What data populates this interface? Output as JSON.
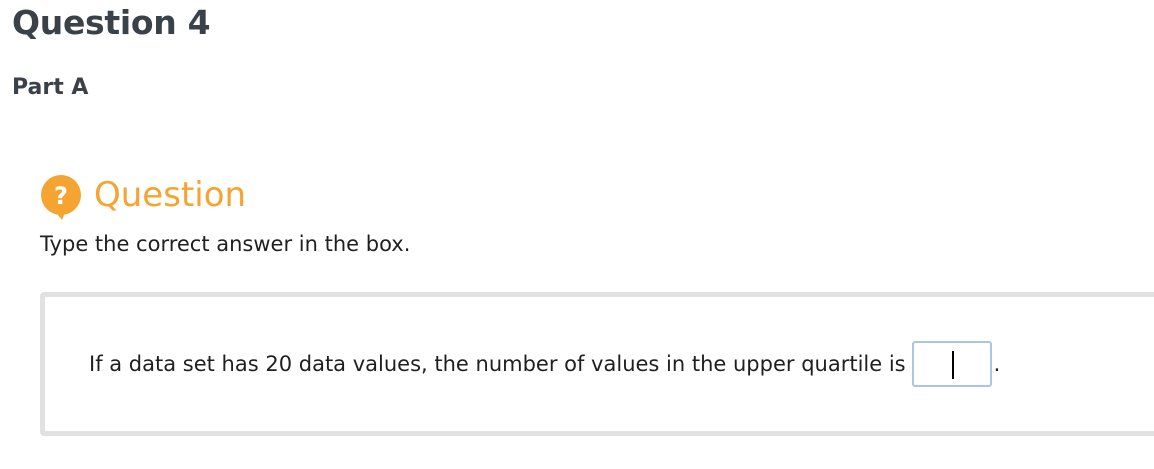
{
  "header": {
    "question_title": "Question 4",
    "part_title": "Part A"
  },
  "question": {
    "icon": "question-mark-bubble-icon",
    "label": "Question",
    "instruction": "Type the correct answer in the box.",
    "prompt_before": "If a data set has 20 data values, the number of values in the upper quartile is",
    "answer_value": "",
    "prompt_after": "."
  },
  "colors": {
    "accent": "#f5a431",
    "heading": "#3a4148",
    "panel_border": "#e1e1e1",
    "input_border": "#a9c6ea"
  }
}
